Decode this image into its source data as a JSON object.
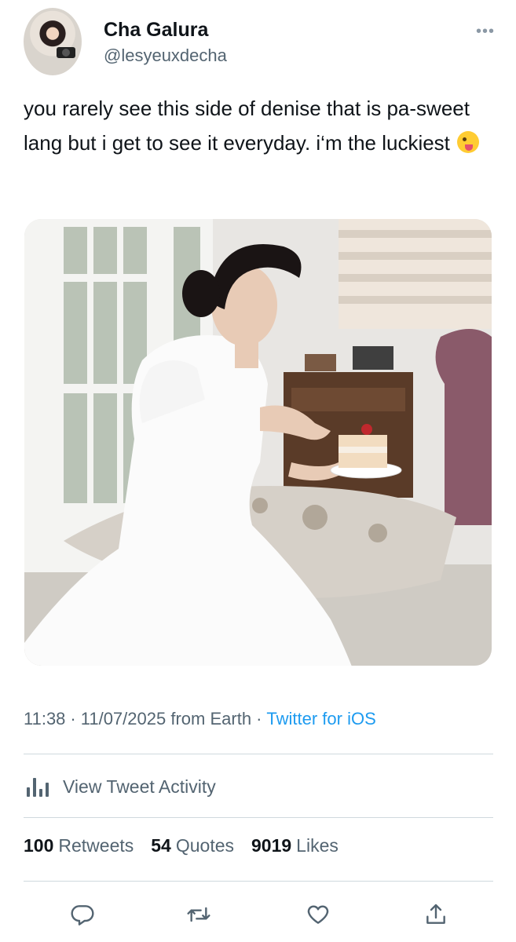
{
  "tweet": {
    "author_name": "Cha Galura",
    "author_handle": "@lesyeuxdecha",
    "more_icon": "more-horizontal-icon",
    "text": "you rarely see this side of denise that is pa-sweet lang but i get to see it everyday. i‘m the luckiest",
    "emoji": "winking-face-with-tongue",
    "time": "11:38",
    "date": "11/07/2025",
    "location_text": "from Earth",
    "source": "Twitter for iOS"
  },
  "activity": {
    "label": "View Tweet Activity",
    "icon": "bar-chart-icon"
  },
  "stats": [
    {
      "count": "100",
      "label": "Retweets"
    },
    {
      "count": "54",
      "label": "Quotes"
    },
    {
      "count": "9019",
      "label": "Likes"
    }
  ],
  "actions": [
    {
      "name": "reply",
      "icon": "reply-icon"
    },
    {
      "name": "retweet",
      "icon": "retweet-icon"
    },
    {
      "name": "like",
      "icon": "heart-icon"
    },
    {
      "name": "share",
      "icon": "share-icon"
    }
  ],
  "colors": {
    "text": "#0f1419",
    "secondary": "#536471",
    "link": "#1d9bf0",
    "divider": "#cfd9de"
  }
}
